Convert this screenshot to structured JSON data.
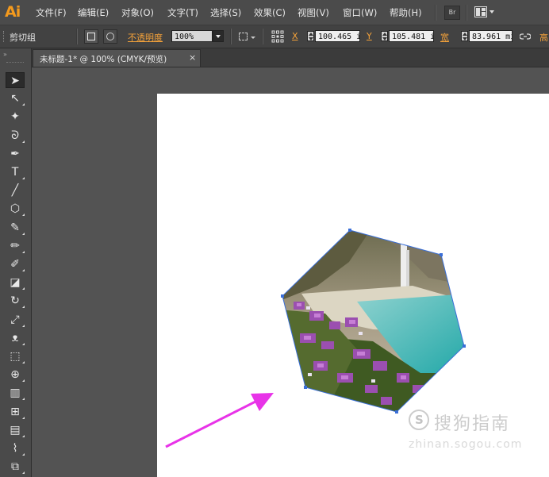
{
  "app": {
    "logo": "Ai"
  },
  "menu": {
    "items": [
      "文件(F)",
      "编辑(E)",
      "对象(O)",
      "文字(T)",
      "选择(S)",
      "效果(C)",
      "视图(V)",
      "窗口(W)",
      "帮助(H)"
    ],
    "bridge_label": "Br"
  },
  "control_bar": {
    "selection_type": "剪切组",
    "opacity_label": "不透明度",
    "opacity_value": "100%",
    "x_label": "X",
    "x_value": "100.465 i",
    "y_label": "Y",
    "y_value": "105.481 i",
    "w_label": "宽",
    "w_value": "83.961 mi",
    "h_label": "高"
  },
  "document_tab": {
    "title": "未标题-1* @ 100% (CMYK/预览)",
    "close_glyph": "×"
  },
  "tools": [
    {
      "name": "selection-tool",
      "glyph": "➤"
    },
    {
      "name": "direct-selection-tool",
      "glyph": "↖"
    },
    {
      "name": "magic-wand-tool",
      "glyph": "✦"
    },
    {
      "name": "lasso-tool",
      "glyph": "ᘐ"
    },
    {
      "name": "pen-tool",
      "glyph": "✒"
    },
    {
      "name": "type-tool",
      "glyph": "T"
    },
    {
      "name": "line-tool",
      "glyph": "╱"
    },
    {
      "name": "polygon-tool",
      "glyph": "⬡"
    },
    {
      "name": "paintbrush-tool",
      "glyph": "✎"
    },
    {
      "name": "pencil-tool",
      "glyph": "✏"
    },
    {
      "name": "blob-brush-tool",
      "glyph": "✐"
    },
    {
      "name": "eraser-tool",
      "glyph": "◪"
    },
    {
      "name": "rotate-tool",
      "glyph": "↻"
    },
    {
      "name": "scale-tool",
      "glyph": "⤢"
    },
    {
      "name": "warp-tool",
      "glyph": "ᴥ"
    },
    {
      "name": "free-transform-tool",
      "glyph": "⬚"
    },
    {
      "name": "shape-builder-tool",
      "glyph": "⊕"
    },
    {
      "name": "graph-tool",
      "glyph": "▥"
    },
    {
      "name": "mesh-tool",
      "glyph": "⊞"
    },
    {
      "name": "gradient-tool",
      "glyph": "▤"
    },
    {
      "name": "eyedropper-tool",
      "glyph": "⌇"
    },
    {
      "name": "blend-tool",
      "glyph": "⧉"
    }
  ],
  "canvas": {
    "arrow_color": "#e833e8",
    "path_color": "#3a6fd8"
  },
  "watermark": {
    "cn": "搜狗指南",
    "url": "zhinan.sogou.com"
  }
}
